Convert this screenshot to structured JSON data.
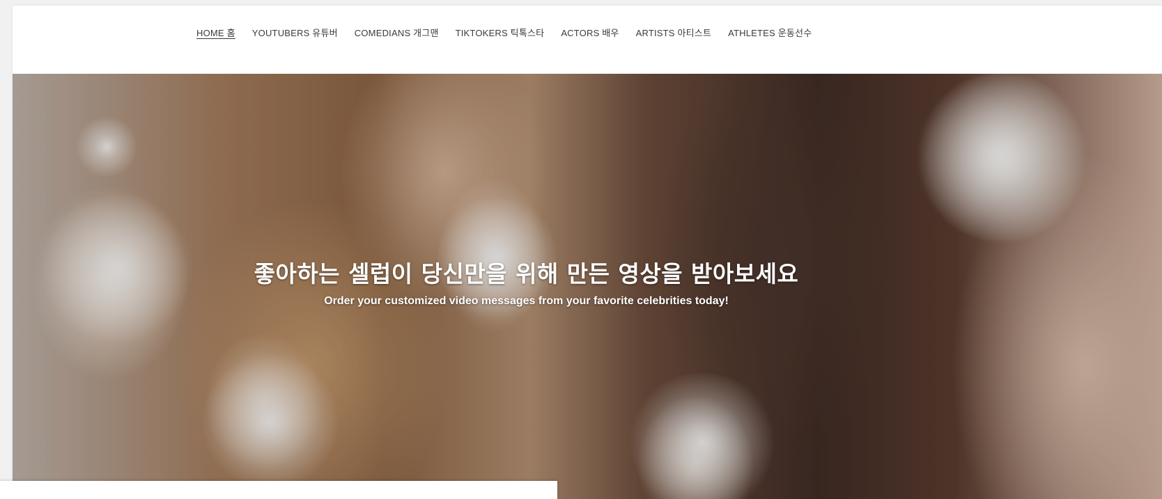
{
  "nav": {
    "items": [
      {
        "label": "HOME 홈",
        "active": true
      },
      {
        "label": "YOUTUBERS 유튜버",
        "active": false
      },
      {
        "label": "COMEDIANS 개그맨",
        "active": false
      },
      {
        "label": "TIKTOKERS 틱톡스타",
        "active": false
      },
      {
        "label": "ACTORS 배우",
        "active": false
      },
      {
        "label": "ARTISTS 아티스트",
        "active": false
      },
      {
        "label": "ATHLETES 운동선수",
        "active": false
      }
    ]
  },
  "hero": {
    "heading": "좋아하는 셀럽이 당신만을 위해 만든 영상을 받아보세요",
    "subheading": "Order your customized video messages from your favorite celebrities today!"
  },
  "colors": {
    "nav_text": "#3a3a3a",
    "hero_text": "#ffffff"
  }
}
